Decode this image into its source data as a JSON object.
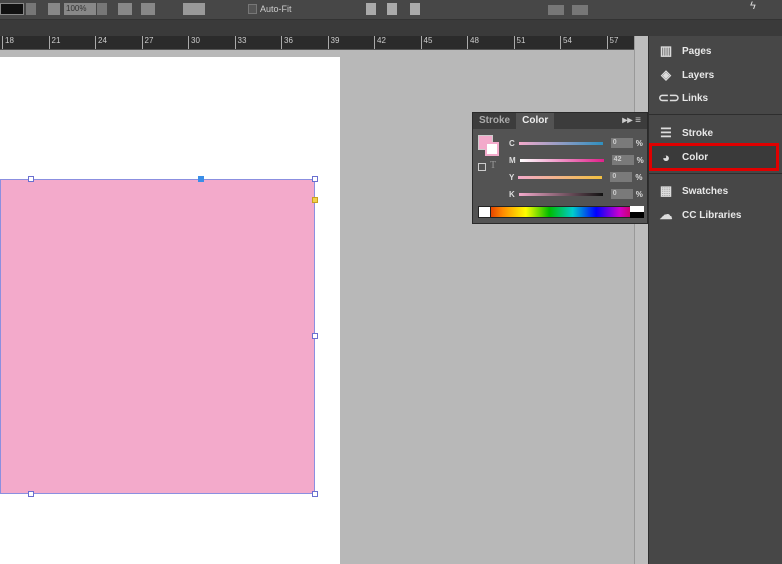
{
  "toolbar": {
    "zoom": "100%",
    "autofit": "Auto-Fit"
  },
  "ruler": {
    "ticks": [
      "18",
      "21",
      "24",
      "27",
      "30",
      "33",
      "36",
      "39",
      "42",
      "45",
      "48",
      "51",
      "54",
      "57"
    ]
  },
  "color_panel": {
    "tabs": [
      "Stroke",
      "Color"
    ],
    "active_tab": "Color",
    "fill_color": "#f3aacb",
    "channels": [
      {
        "label": "C",
        "value": "0",
        "gradient": "linear-gradient(90deg,#f3aacb,#2e8fbf)"
      },
      {
        "label": "M",
        "value": "42",
        "gradient": "linear-gradient(90deg,#fff,#e0208a)"
      },
      {
        "label": "Y",
        "value": "0",
        "gradient": "linear-gradient(90deg,#f3aacb,#f2c040)"
      },
      {
        "label": "K",
        "value": "0",
        "gradient": "linear-gradient(90deg,#f3aacb,#111)"
      }
    ],
    "percent": "%"
  },
  "dock": {
    "items": [
      {
        "label": "Pages",
        "icon": "pages-icon",
        "glyph": "▥"
      },
      {
        "label": "Layers",
        "icon": "layers-icon",
        "glyph": "◈"
      },
      {
        "label": "Links",
        "icon": "links-icon",
        "glyph": "⊂⊃"
      },
      {
        "label": "Stroke",
        "icon": "stroke-icon",
        "glyph": "☰"
      },
      {
        "label": "Color",
        "icon": "palette-icon",
        "glyph": "◕"
      },
      {
        "label": "Swatches",
        "icon": "swatches-icon",
        "glyph": "▦"
      },
      {
        "label": "CC Libraries",
        "icon": "cc-libraries-icon",
        "glyph": "☁"
      }
    ],
    "highlighted": "Color",
    "highlight_color": "#e00000"
  }
}
